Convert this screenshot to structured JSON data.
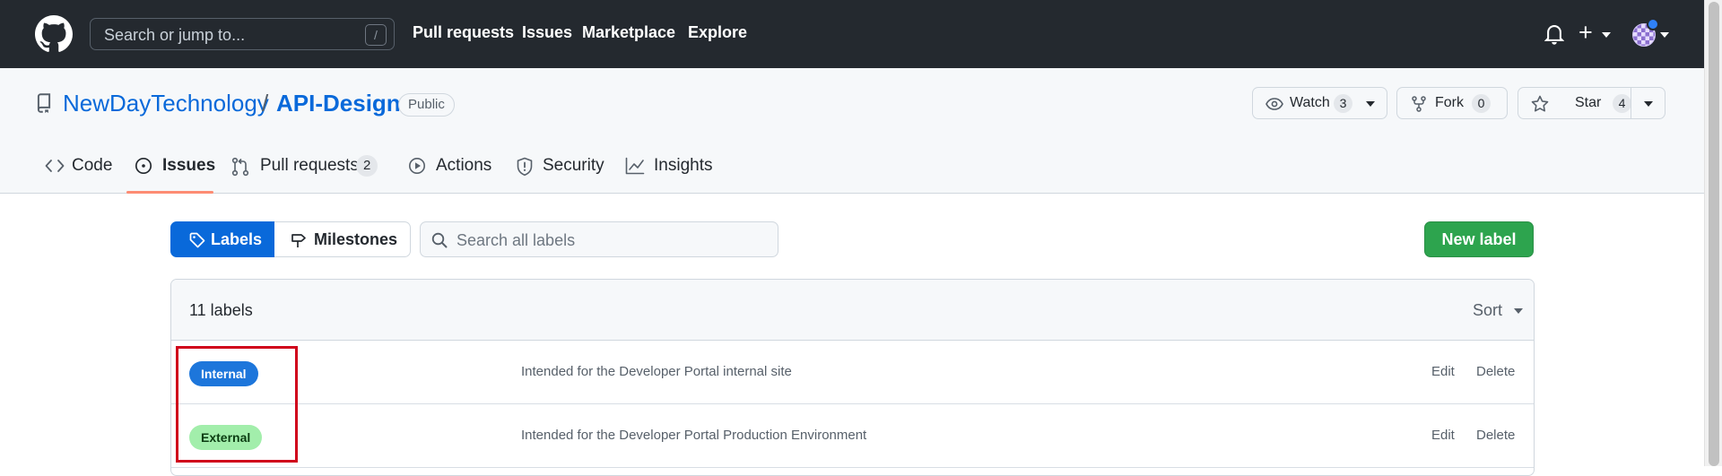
{
  "header": {
    "search_placeholder": "Search or jump to...",
    "search_shortcut": "/",
    "nav": [
      "Pull requests",
      "Issues",
      "Marketplace",
      "Explore"
    ]
  },
  "repo": {
    "owner": "NewDayTechnology",
    "separator": "/",
    "name": "API-Design",
    "visibility": "Public",
    "watch": {
      "label": "Watch",
      "count": "3"
    },
    "fork": {
      "label": "Fork",
      "count": "0"
    },
    "star": {
      "label": "Star",
      "count": "4"
    }
  },
  "tabs": [
    {
      "label": "Code",
      "icon": "code-icon"
    },
    {
      "label": "Issues",
      "icon": "issue-opened-icon"
    },
    {
      "label": "Pull requests",
      "icon": "git-pull-request-icon",
      "count": "2"
    },
    {
      "label": "Actions",
      "icon": "play-icon"
    },
    {
      "label": "Security",
      "icon": "shield-icon"
    },
    {
      "label": "Insights",
      "icon": "graph-icon"
    }
  ],
  "subnav": {
    "labels": "Labels",
    "milestones": "Milestones",
    "search_placeholder": "Search all labels",
    "new_label": "New label"
  },
  "labels_box": {
    "count_text": "11 labels",
    "sort": "Sort",
    "rows": [
      {
        "name": "Internal",
        "color": "#1d76db",
        "text_color": "#ffffff",
        "description": "Intended for the Developer Portal internal site",
        "edit": "Edit",
        "delete": "Delete"
      },
      {
        "name": "External",
        "color": "#a2eeab",
        "text_color": "#0b3d12",
        "description": "Intended for the Developer Portal Production Environment",
        "edit": "Edit",
        "delete": "Delete"
      }
    ]
  },
  "colors": {
    "accent": "#0969da",
    "header_bg": "#24292f",
    "primary_button": "#2da44e",
    "highlight": "#d0021b"
  }
}
